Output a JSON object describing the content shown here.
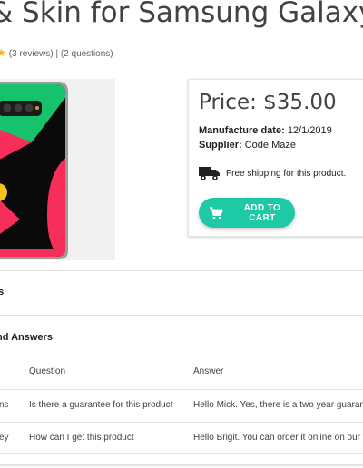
{
  "product": {
    "title": "& Skin for Samsung Galaxy",
    "rating_text": "(3 reviews) | (2 questions)",
    "price": "Price: $35.00",
    "manufacture_label": "Manufacture date:",
    "manufacture_value": "12/1/2019",
    "supplier_label": "Supplier:",
    "supplier_value": "Code Maze",
    "shipping_text": "Free shipping for this product.",
    "add_to_cart_label": "ADD TO CART"
  },
  "reviews": {
    "title_fragment": "vs"
  },
  "qa": {
    "title_fragment": "nd Answers",
    "columns": [
      "Question",
      "Answer"
    ],
    "rows": [
      {
        "name_fragment": "ns",
        "question": "Is there a guarantee for this product",
        "answer": "Hello Mick. Yes, there is a two year guarante"
      },
      {
        "name_fragment": "ey",
        "question": "How can I get this product",
        "answer": "Hello Brigit. You can order it online on our w"
      }
    ]
  },
  "colors": {
    "accent": "#1ec9a5",
    "star": "#f2b705"
  },
  "icons": [
    "star-icon",
    "truck-icon",
    "cart-icon"
  ]
}
